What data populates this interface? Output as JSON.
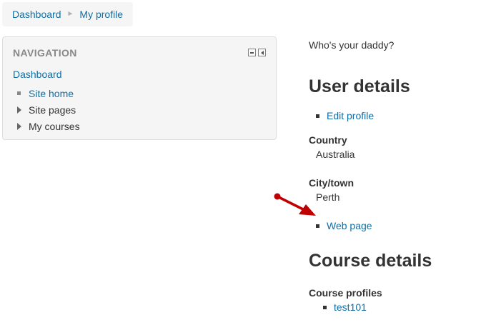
{
  "breadcrumb": {
    "items": [
      "Dashboard",
      "My profile"
    ],
    "separator": "►"
  },
  "navigation": {
    "header": "NAVIGATION",
    "root": "Dashboard",
    "items": [
      {
        "label": "Site home",
        "kind": "link",
        "icon": "square-bullet"
      },
      {
        "label": "Site pages",
        "kind": "branch",
        "icon": "triangle-right"
      },
      {
        "label": "My courses",
        "kind": "branch",
        "icon": "triangle-right"
      }
    ]
  },
  "profile": {
    "description": "Who's your daddy?",
    "user_details_heading": "User details",
    "edit_profile_link": "Edit profile",
    "country_label": "Country",
    "country_value": "Australia",
    "city_label": "City/town",
    "city_value": "Perth",
    "web_page_link": "Web page",
    "course_details_heading": "Course details",
    "course_profiles_label": "Course profiles",
    "courses": [
      "test101"
    ]
  },
  "colors": {
    "link": "#0f6fa5",
    "text": "#333333",
    "panel_bg": "#f5f5f5",
    "annotation_arrow": "#c00000"
  }
}
